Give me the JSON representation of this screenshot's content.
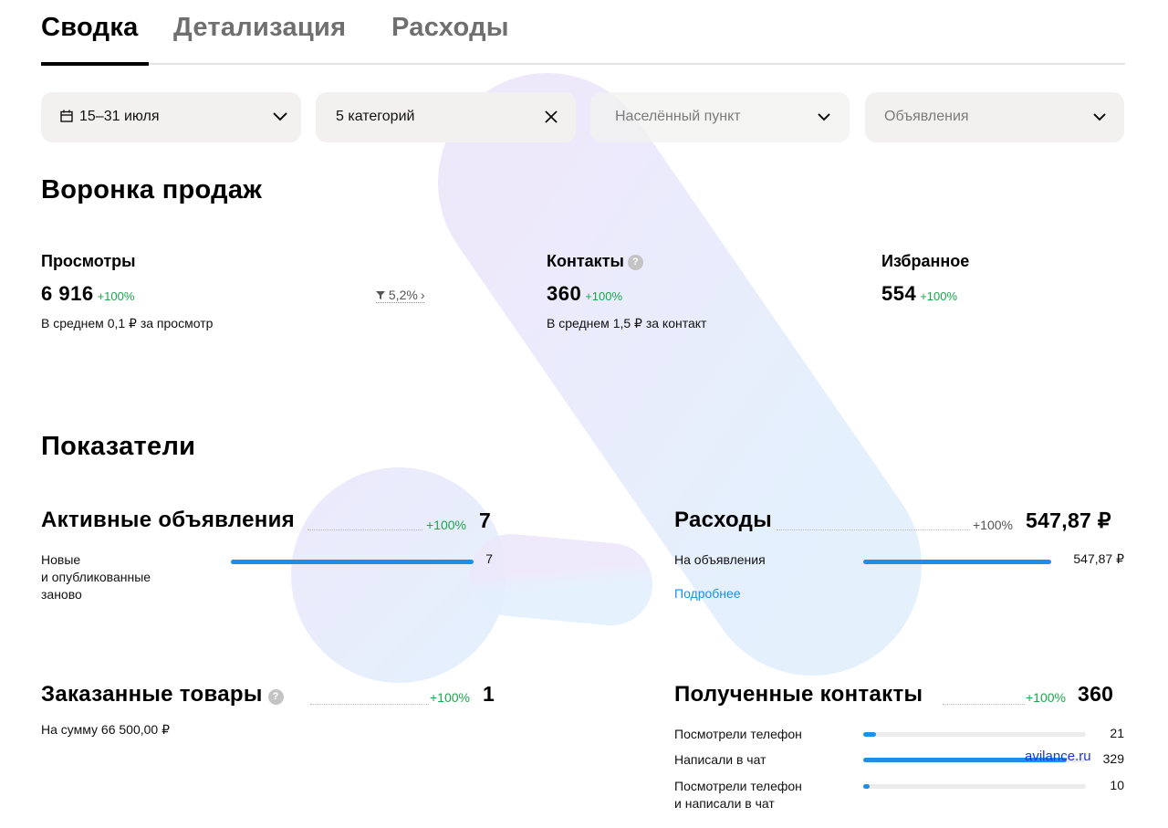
{
  "tabs": [
    {
      "label": "Сводка",
      "active": true
    },
    {
      "label": "Детализация",
      "active": false
    },
    {
      "label": "Расходы",
      "active": false
    }
  ],
  "filters": {
    "period": {
      "value": "15–31 июля",
      "icon": "calendar-icon"
    },
    "categories": {
      "value": "5 категорий",
      "icon": "close-icon"
    },
    "location": {
      "placeholder": "Населённый пункт",
      "icon": "chevron-down-icon"
    },
    "ads": {
      "placeholder": "Объявления",
      "icon": "chevron-down-icon"
    }
  },
  "funnel": {
    "title": "Воронка продаж",
    "views": {
      "title": "Просмотры",
      "value": "6 916",
      "delta": "+100%",
      "sub": "В среднем 0,1 ₽ за просмотр"
    },
    "conversion": "5,2%",
    "contacts": {
      "title": "Контакты",
      "value": "360",
      "delta": "+100%",
      "sub": "В среднем 1,5 ₽ за контакт"
    },
    "favorites": {
      "title": "Избранное",
      "value": "554",
      "delta": "+100%"
    }
  },
  "indicators": {
    "title": "Показатели",
    "active_ads": {
      "title": "Активные объявления",
      "delta": "+100%",
      "total": "7",
      "rows": [
        {
          "label": "Новые\nи опубликованные\nзаново",
          "value": "7",
          "fraction": 1.0
        }
      ]
    },
    "expenses": {
      "title": "Расходы",
      "delta": "+100%",
      "total": "547,87 ₽",
      "rows": [
        {
          "label": "На объявления",
          "value": "547,87 ₽",
          "fraction": 1.0
        }
      ],
      "link": "Подробнее"
    },
    "ordered": {
      "title": "Заказанные товары",
      "delta": "+100%",
      "total": "1",
      "sub": "На сумму 66 500,00 ₽"
    },
    "received_contacts": {
      "title": "Полученные контакты",
      "delta": "+100%",
      "total": "360",
      "rows": [
        {
          "label": "Посмотрели телефон",
          "value": "21",
          "fraction": 0.058
        },
        {
          "label": "Написали в чат",
          "value": "329",
          "fraction": 0.914
        },
        {
          "label": "Посмотрели телефон\nи написали в чат",
          "value": "10",
          "fraction": 0.028
        }
      ]
    }
  },
  "watermark": {
    "text": "avilance.ru",
    "color": "#1e35d6"
  },
  "colors": {
    "accent": "#1e8fe8",
    "positive": "#1aa64b",
    "filter_bg": "#f2f1f0"
  }
}
